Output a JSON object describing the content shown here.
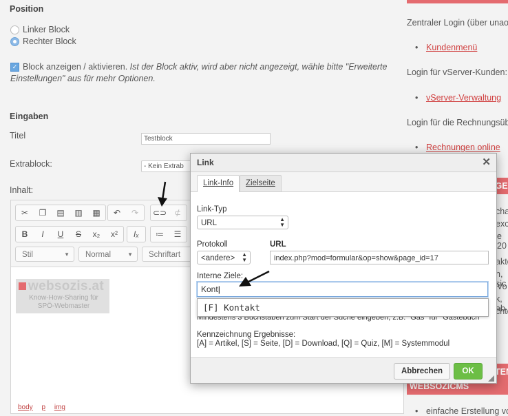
{
  "position": {
    "heading": "Position",
    "options": [
      "Linker Block",
      "Rechter Block"
    ],
    "selected_index": 1,
    "activate_label": "Block anzeigen / aktivieren.",
    "activate_hint": "Ist der Block aktiv, wird aber nicht angezeigt, wähle bitte \"Erweiterte Einstellungen\" aus für mehr Optionen."
  },
  "inputs": {
    "heading": "Eingaben",
    "title_label": "Titel",
    "title_value": "Testblock",
    "extrablock_label": "Extrablock:",
    "extrablock_value": "- Kein Extrab",
    "content_label": "Inhalt:"
  },
  "editor": {
    "toolbar_combos": [
      "Stil",
      "Normal",
      "Schriftart"
    ],
    "icons_row1": [
      "cut-icon",
      "copy-icon",
      "paste-icon",
      "paste-text-icon",
      "paste-word-icon",
      "undo-icon",
      "redo-icon",
      "link-icon",
      "unlink-icon"
    ],
    "icons_row2": [
      "bold-icon",
      "italic-icon",
      "underline-icon",
      "strike-icon",
      "subscript-icon",
      "superscript-icon",
      "remove-format-icon",
      "numbered-list-icon",
      "bulleted-list-icon"
    ],
    "logo_text": "websozis.at",
    "logo_sub1": "Know-How-Sharing für",
    "logo_sub2": "SPÖ-Webmaster",
    "path": [
      "body",
      "p",
      "img"
    ]
  },
  "sidebar": {
    "line1": "Zentraler Login (über unaor",
    "link1": "Kundenmenü",
    "line2": "Login für vServer-Kunden:",
    "link2": "vServer-Verwaltung",
    "line3": "Login für die Rechnungsüb",
    "link3": "Rechnungen online",
    "banner_partial": "IGE",
    "frag": [
      "chan",
      "exch",
      "e 20",
      "akte",
      "n, sic",
      "Vo",
      "k, ab",
      "chten"
    ],
    "banner_bottom1": "TEN",
    "banner_bottom2": "WEBSOZICMS",
    "bottom_text": "einfache Erstellung vo"
  },
  "dialog": {
    "title": "Link",
    "tabs": [
      "Link-Info",
      "Zielseite"
    ],
    "linktype_label": "Link-Typ",
    "linktype_value": "URL",
    "protocol_label": "Protokoll",
    "protocol_value": "<andere>",
    "url_label": "URL",
    "url_value": "index.php?mod=formular&op=show&page_id=17",
    "internal_label": "Interne Ziele:",
    "internal_value": "Kont",
    "suggestion": "[F] Kontakt",
    "hint_partial": "Mindestens 3 Buchstaben zum Start der Suche eingeben, z.B. \"Gas\" für \"Gästebuch\"",
    "legend_label": "Kennzeichnung Ergebnisse:",
    "legend_text": "[A] = Artikel, [S] = Seite, [D] = Download, [Q] = Quiz, [M] = Systemmodul",
    "cancel_label": "Abbrechen",
    "ok_label": "OK"
  },
  "colors": {
    "accent_red": "#e46b6f",
    "ok_green": "#6cbe45",
    "link_red": "#d04040"
  }
}
